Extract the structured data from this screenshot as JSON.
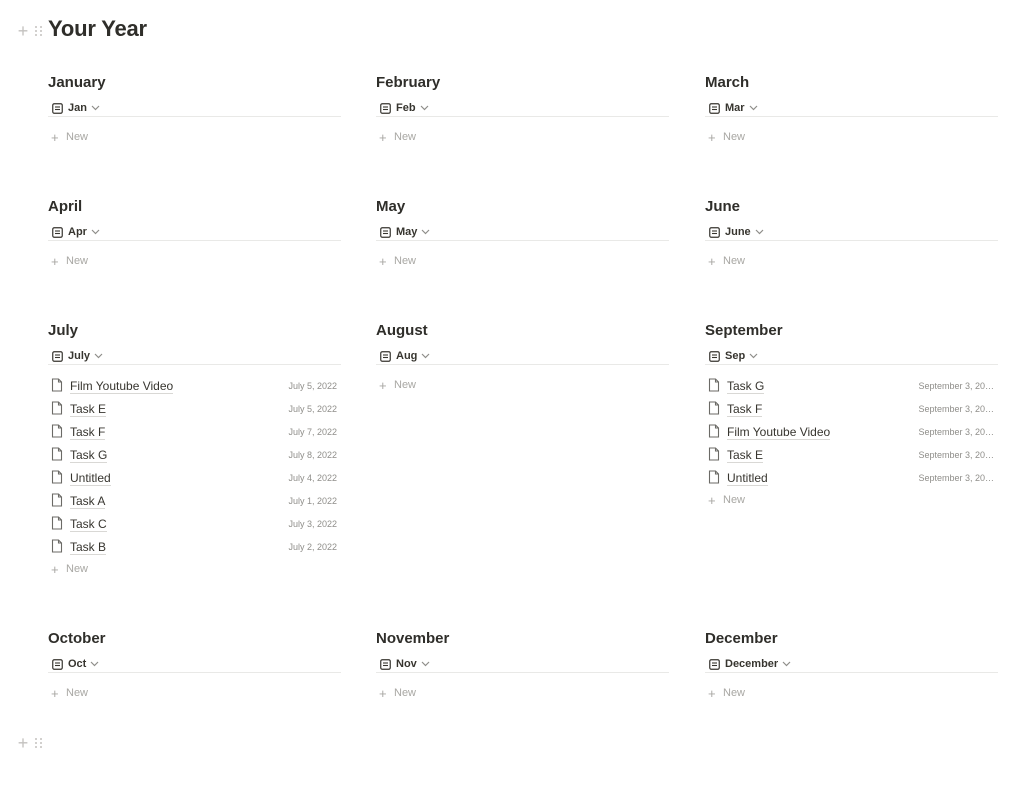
{
  "page": {
    "title": "Your Year"
  },
  "new_label": "New",
  "months": [
    {
      "title": "January",
      "view": "Jan",
      "items": []
    },
    {
      "title": "February",
      "view": "Feb",
      "items": []
    },
    {
      "title": "March",
      "view": "Mar",
      "items": []
    },
    {
      "title": "April",
      "view": "Apr",
      "items": []
    },
    {
      "title": "May",
      "view": "May",
      "items": []
    },
    {
      "title": "June",
      "view": "June",
      "items": []
    },
    {
      "title": "July",
      "view": "July",
      "items": [
        {
          "name": "Film Youtube Video",
          "date": "July 5, 2022"
        },
        {
          "name": "Task E",
          "date": "July 5, 2022"
        },
        {
          "name": "Task F",
          "date": "July 7, 2022"
        },
        {
          "name": "Task G",
          "date": "July 8, 2022"
        },
        {
          "name": "Untitled",
          "date": "July 4, 2022"
        },
        {
          "name": "Task A",
          "date": "July 1, 2022"
        },
        {
          "name": "Task C",
          "date": "July 3, 2022"
        },
        {
          "name": "Task B",
          "date": "July 2, 2022"
        }
      ]
    },
    {
      "title": "August",
      "view": "Aug",
      "items": []
    },
    {
      "title": "September",
      "view": "Sep",
      "items": [
        {
          "name": "Task G",
          "date": "September 3, 20…"
        },
        {
          "name": "Task F",
          "date": "September 3, 20…"
        },
        {
          "name": "Film Youtube Video",
          "date": "September 3, 20…"
        },
        {
          "name": "Task E",
          "date": "September 3, 20…"
        },
        {
          "name": "Untitled",
          "date": "September 3, 20…"
        }
      ]
    },
    {
      "title": "October",
      "view": "Oct",
      "items": []
    },
    {
      "title": "November",
      "view": "Nov",
      "items": []
    },
    {
      "title": "December",
      "view": "December",
      "items": []
    }
  ]
}
